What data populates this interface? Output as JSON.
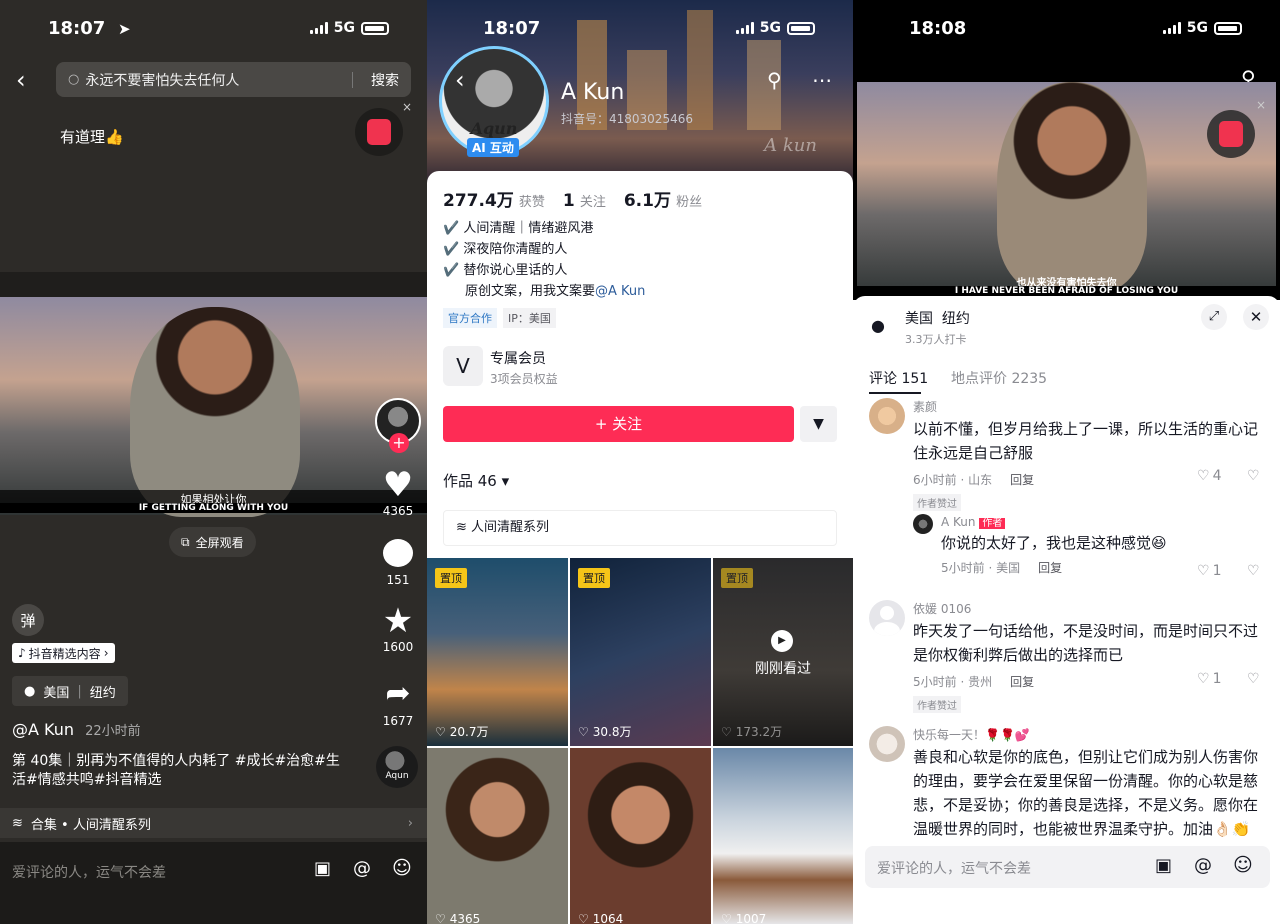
{
  "panel1": {
    "time": "18:07",
    "network": "5G",
    "search_value": "永远不要害怕失去任何人",
    "search_button": "搜索",
    "comment_top": "有道理👍",
    "subtitle_cn": "如果相处让你",
    "subtitle_en": "IF GETTING ALONG WITH YOU",
    "fullscreen": "全屏观看",
    "likes": "4365",
    "comments": "151",
    "stars": "1600",
    "shares": "1677",
    "danmu": "弹",
    "featured_badge": "抖音精选内容",
    "location_country": "美国",
    "location_city": "纽约",
    "author": "@A Kun",
    "time_ago": "22小时前",
    "caption": "第 40集｜别再为不值得的人内耗了 #成长#治愈#生活#情感共鸣#抖音精选",
    "collection": "合集 • 人间清醒系列",
    "comment_placeholder": "爱评论的人，运气不会差",
    "avatar_text": "Aqun"
  },
  "panel2": {
    "time": "18:07",
    "network": "5G",
    "name": "A Kun",
    "douyin_id": "抖音号：41803025466",
    "avatar_script": "Aqun",
    "ai_badge": "AI 互动",
    "signature_watermark": "A kun",
    "stats": [
      {
        "value": "277.4万",
        "label": "获赞"
      },
      {
        "value": "1",
        "label": "关注"
      },
      {
        "value": "6.1万",
        "label": "粉丝"
      }
    ],
    "bio": [
      "✔️ 人间清醒｜情绪避风港",
      "✔️ 深夜陪你清醒的人",
      "✔️ 替你说心里话的人",
      "原创文案，用我文案要",
      "@A Kun"
    ],
    "official": "官方合作",
    "ip": "IP：美国",
    "member_title": "专属会员",
    "member_sub": "3项会员权益",
    "follow_button": "+ 关注",
    "works": "作品 46",
    "series": "人间清醒系列",
    "pinned": "置顶",
    "just_watched": "刚刚看过",
    "tiles": [
      {
        "likes": "20.7万"
      },
      {
        "likes": "30.8万"
      },
      {
        "likes": "173.2万"
      },
      {
        "likes": "4365"
      },
      {
        "likes": "1064"
      },
      {
        "likes": "1007"
      }
    ]
  },
  "panel3": {
    "time": "18:08",
    "network": "5G",
    "subtitle_cn": "也从来没有害怕失去你",
    "subtitle_en": "I HAVE NEVER BEEN AFRAID OF LOSING YOU",
    "place_country": "美国",
    "place_city": "纽约",
    "checkins": "3.3万人打卡",
    "tab_comments": "评论 151",
    "tab_reviews": "地点评价 2235",
    "comments": [
      {
        "name": "素颜",
        "text": "以前不懂，但岁月给我上了一课，所以生活的重心记住永远是自己舒服",
        "meta": "6小时前 · 山东",
        "reply": "回复",
        "likes": "4",
        "liked": "作者赞过"
      },
      {
        "name": "A Kun",
        "author_tag": "作者",
        "text": "你说的太好了，我也是这种感觉😆",
        "meta": "5小时前 · 美国",
        "reply": "回复",
        "likes": "1"
      },
      {
        "name": "依媛 0106",
        "text": "昨天发了一句话给他，不是没时间，而是时间只不过是你权衡利弊后做出的选择而已",
        "meta": "5小时前 · 贵州",
        "reply": "回复",
        "likes": "1",
        "liked": "作者赞过"
      },
      {
        "name": "快乐每一天！🌹🌹💕",
        "text": "善良和心软是你的底色，但别让它们成为别人伤害你的理由，要学会在爱里保留一份清醒。你的心软是慈悲，不是妥协；你的善良是选择，不是义务。愿你在温暖世界的同时，也能被世界温柔守护。加油👌🏻👏👏👏"
      }
    ],
    "input_placeholder": "爱评论的人，运气不会差"
  }
}
